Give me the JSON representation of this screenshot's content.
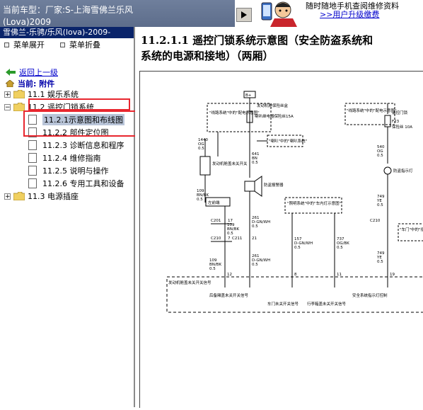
{
  "header": {
    "car_type_label": "当前车型：",
    "car_type_value": "厂家:S-上海雪佛兰乐风",
    "car_type_line2": "(Lova)2009"
  },
  "promo": {
    "line1": "随时随地手机查阅维修资料",
    "link": ">>用户升级缴费"
  },
  "sidebar": {
    "branch_title": "雪佛兰-乐骋/乐风(lova)-2009-",
    "expand_all": "菜单展开",
    "collapse_all": "菜单折叠",
    "back_link": "返回上一级",
    "current": "当前: 附件",
    "tree": [
      {
        "label": "11.1 娱乐系统",
        "state": "collapsed"
      },
      {
        "label": "11.2 遥控门锁系统",
        "state": "expanded"
      },
      {
        "label": "11.2.1示意图和布线图",
        "selected": true
      },
      {
        "label": "11.2.2 部件定位图"
      },
      {
        "label": "11.2.3 诊断信息和程序"
      },
      {
        "label": "11.2.4 维修指南"
      },
      {
        "label": "11.2.5 说明与操作"
      },
      {
        "label": "11.2.6 专用工具和设备"
      },
      {
        "label": "11.3 电源插座",
        "state": "collapsed"
      }
    ]
  },
  "document": {
    "title_line1": "11.2.1.1 遥控门锁系统示意图（安全防盗系统和",
    "title_line2": "系统的电源和接地）（两厢）"
  },
  "diagram": {
    "labels": {
      "bplus": "B+",
      "fuse_box": "发动机舱保险丝盒",
      "ref1": "\"线路系统\"中的\"配电示意图\"",
      "fuse1": "喇叭继电器保险丝15A",
      "horn_ref": "\"喇叭\"中的\"喇叭系统\"",
      "w1440": "1440",
      "w1440_col": "OG",
      "w1440_size": "0.5",
      "w641": "641",
      "w641_col": "BN",
      "w641_size": "0.5",
      "hood_switch": "发动机舱盖未关开关",
      "w109a": "109",
      "w109a_col": "BN/BK",
      "w109a_size": "0.5",
      "siren": "防盗报警器",
      "left_front": "左前端",
      "c201": "C201",
      "c201_pin": "17",
      "c210a": "C210",
      "c210a_pin": "7",
      "w261a": "261",
      "w261a_col": "D-GN/WH",
      "w261a_size": "0.5",
      "c211": "C211",
      "c211_pin": "21",
      "w109b": "109",
      "w109b_col": "BN/BK",
      "w109b_size": "0.5",
      "w261b": "261",
      "w261b_col": "D-GN/WH",
      "w261b_size": "0.5",
      "w109c": "109",
      "w109c_col": "BN/BK",
      "w109c_size": "0.5",
      "lamp_ref": "\"照明系统\"中的\"车内灯示意图\"",
      "w157": "157",
      "w157_col": "D-GN/WH",
      "w157_size": "0.5",
      "w737": "737",
      "w737_col": "OG/BK",
      "w737_size": "0.5",
      "ref2": "\"线路系统\"中的\"配电示意图\"",
      "fuse2a": "遥控门锁",
      "fuse2b": "F23",
      "fuse2c": "保险丝 10A",
      "w540": "540",
      "w540_col": "OG",
      "w540_size": "0.5",
      "sec_lamp": "防盗指示灯",
      "w749a": "749",
      "w749a_col": "YE",
      "w749a_size": "0.5",
      "c210b": "C210",
      "door_ref": "\"车门\"中的\"指示器示意\"",
      "w749b": "749",
      "w749b_col": "YE",
      "w749b_size": "0.5",
      "pin12": "12",
      "pin8": "8",
      "pin11": "11",
      "pin19": "19",
      "hood_signal": "发动机舱盖未关开关信号",
      "trunk_signal": "后备厢盖未关开关信号",
      "door_signal": "车门未关开关信号",
      "lock_signal": "行李箱盖未关开关信号",
      "sec_lamp_ctrl": "安全系统指示灯控制"
    }
  }
}
